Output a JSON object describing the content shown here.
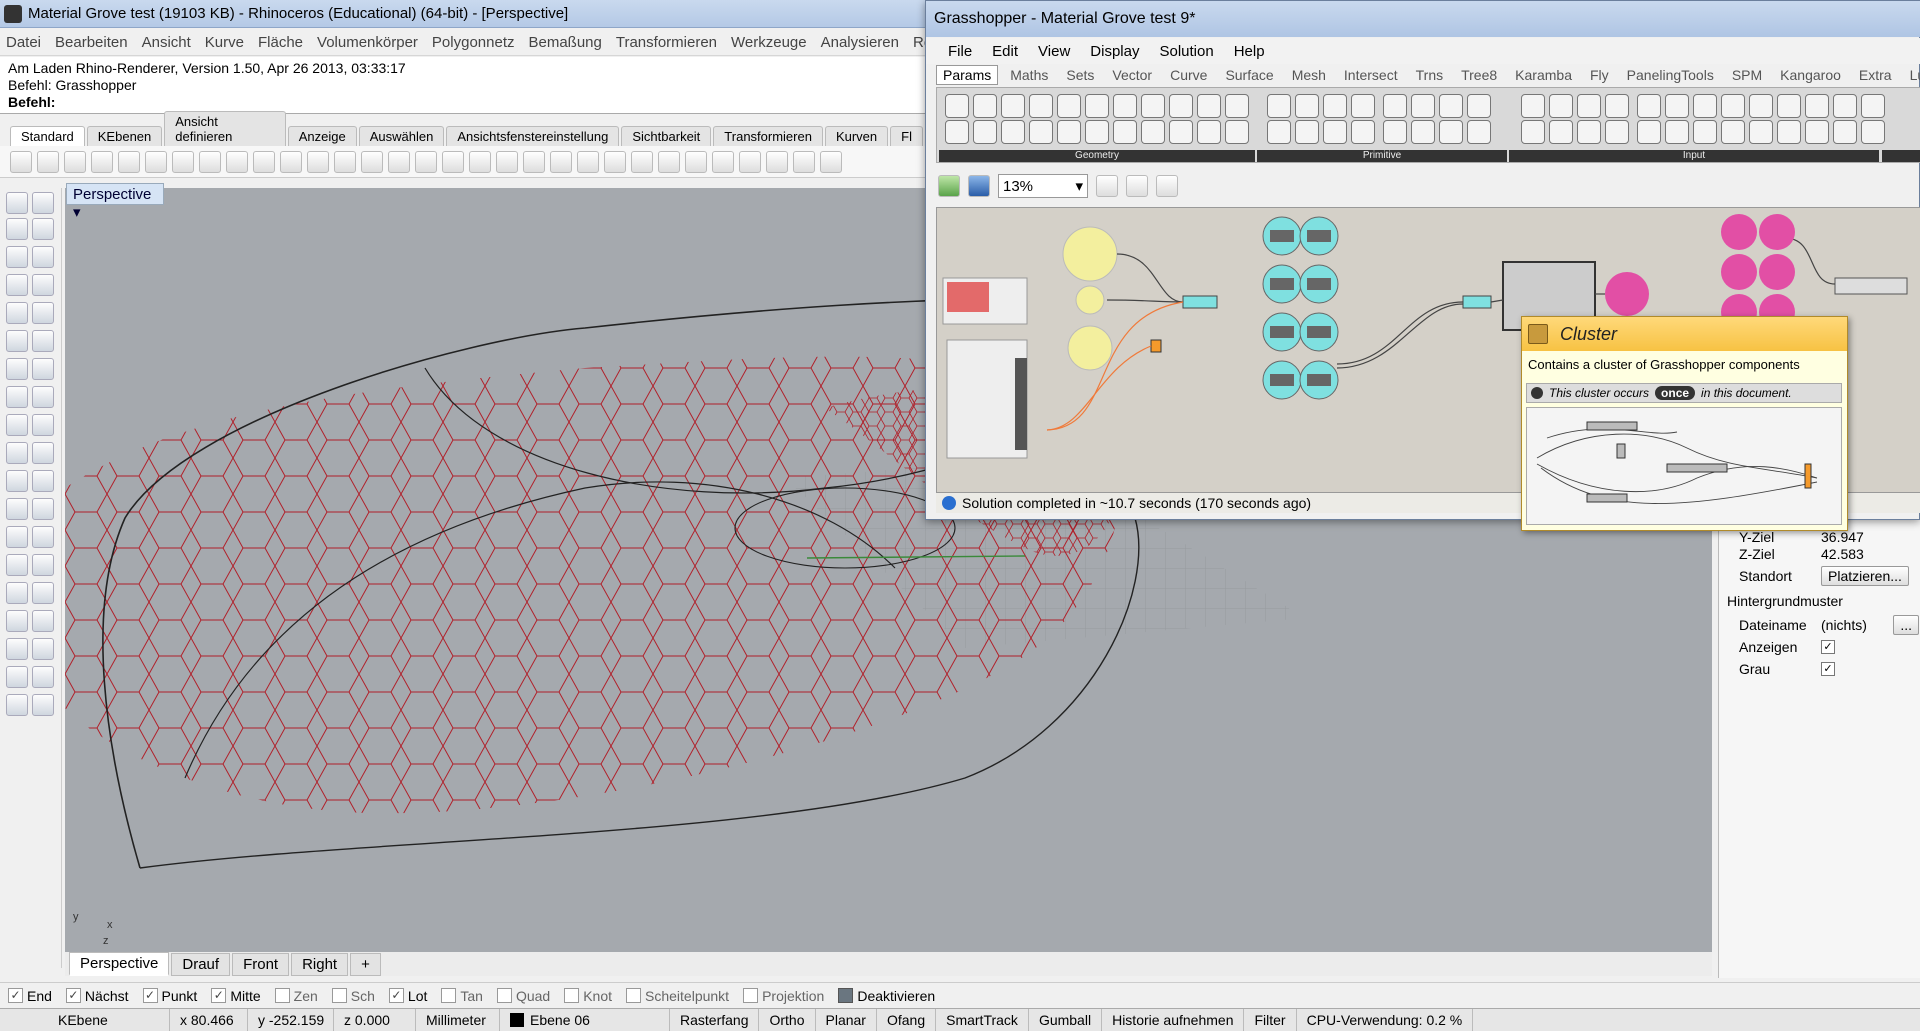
{
  "rhino": {
    "title": "Material Grove test (19103 KB) - Rhinoceros (Educational) (64-bit) - [Perspective]",
    "menu": [
      "Datei",
      "Bearbeiten",
      "Ansicht",
      "Kurve",
      "Fläche",
      "Volumenkörper",
      "Polygonnetz",
      "Bemaßung",
      "Transformieren",
      "Werkzeuge",
      "Analysieren",
      "Re"
    ],
    "cmd_line1": "Am Laden Rhino-Renderer, Version 1.50, Apr 26 2013, 03:33:17",
    "cmd_line2": "Befehl: Grasshopper",
    "cmd_prompt": "Befehl:",
    "toolbar_tabs": [
      "Standard",
      "KEbenen",
      "Ansicht definieren",
      "Anzeige",
      "Auswählen",
      "Ansichtsfenstereinstellung",
      "Sichtbarkeit",
      "Transformieren",
      "Kurven",
      "Fl"
    ],
    "viewport_label": "Perspective",
    "viewport_tabs": [
      "Perspective",
      "Drauf",
      "Front",
      "Right"
    ],
    "add_tab": "+",
    "axis_y": "y",
    "axis_x": "x",
    "axis_z": "z",
    "osnaps": [
      {
        "label": "End",
        "checked": true
      },
      {
        "label": "Nächst",
        "checked": true
      },
      {
        "label": "Punkt",
        "checked": true
      },
      {
        "label": "Mitte",
        "checked": true
      },
      {
        "label": "Zen",
        "checked": false
      },
      {
        "label": "Sch",
        "checked": false
      },
      {
        "label": "Lot",
        "checked": true
      },
      {
        "label": "Tan",
        "checked": false
      },
      {
        "label": "Quad",
        "checked": false
      },
      {
        "label": "Knot",
        "checked": false
      },
      {
        "label": "Scheitelpunkt",
        "checked": false
      },
      {
        "label": "Projektion",
        "checked": false
      },
      {
        "label": "Deaktivieren",
        "checked": false,
        "filled": true
      }
    ],
    "status": {
      "layer_label": "KEbene",
      "x": "x 80.466",
      "y": "y -252.159",
      "z": "z 0.000",
      "units": "Millimeter",
      "layer": "Ebene 06",
      "items": [
        "Rasterfang",
        "Ortho",
        "Planar",
        "Ofang",
        "SmartTrack",
        "Gumball",
        "Historie aufnehmen",
        "Filter",
        "CPU-Verwendung: 0.2 %"
      ]
    },
    "props": {
      "yziel_label": "Y-Ziel",
      "yziel_value": "36.947",
      "zziel_label": "Z-Ziel",
      "zziel_value": "42.583",
      "standort_label": "Standort",
      "standort_button": "Platzieren...",
      "section": "Hintergrundmuster",
      "dateiname_label": "Dateiname",
      "dateiname_value": "(nichts)",
      "browse": "...",
      "anzeigen_label": "Anzeigen",
      "grau_label": "Grau"
    }
  },
  "grasshopper": {
    "title": "Grasshopper - Material Grove test 9*",
    "menu": [
      "File",
      "Edit",
      "View",
      "Display",
      "Solution",
      "Help"
    ],
    "tabs": [
      "Params",
      "Maths",
      "Sets",
      "Vector",
      "Curve",
      "Surface",
      "Mesh",
      "Intersect",
      "Trns",
      "Tree8",
      "Karamba",
      "Fly",
      "PanelingTools",
      "SPM",
      "Kangaroo",
      "Extra",
      "LunchBox"
    ],
    "active_tab": "Params",
    "ribbon_groups": [
      "Geometry",
      "Primitive",
      "Input"
    ],
    "zoom": "13%",
    "status": "Solution completed in ~10.7 seconds (170 seconds ago)",
    "tooltip": {
      "title": "Cluster",
      "description": "Contains a cluster of Grasshopper components",
      "occurs_pre": "This cluster occurs",
      "occurs_pill": "once",
      "occurs_post": "in this document."
    }
  },
  "colors": {
    "mesh": "#b0202a",
    "viewport_bg": "#a5a9ae",
    "gh_canvas": "#d4d0c8",
    "cyan_node": "#7fe0e0",
    "magenta_node": "#e24fa5",
    "yellow_node": "#f3ef9e"
  }
}
